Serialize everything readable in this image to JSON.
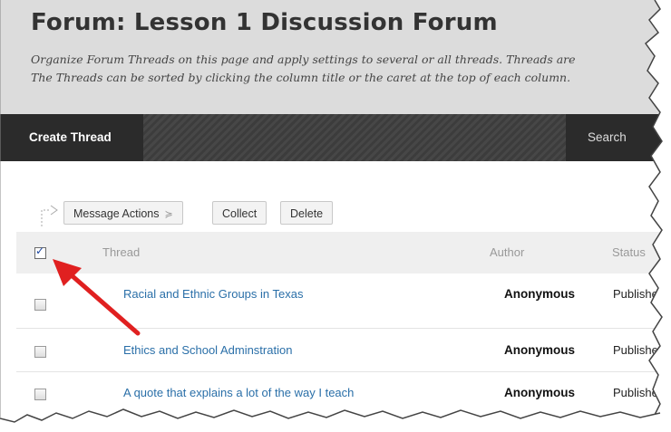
{
  "forum": {
    "title": "Forum: Lesson 1 Discussion Forum",
    "desc_line1": "Organize Forum Threads on this page and apply settings to several or all threads. Threads are",
    "desc_line2": "The Threads can be sorted by clicking the column title or the caret at the top of each column."
  },
  "actionbar": {
    "create_label": "Create Thread",
    "search_label": "Search"
  },
  "toolbar": {
    "message_actions_label": "Message Actions",
    "collect_label": "Collect",
    "delete_label": "Delete"
  },
  "table": {
    "headers": {
      "thread": "Thread",
      "author": "Author",
      "status": "Status"
    },
    "rows": [
      {
        "thread": "Racial and Ethnic Groups in Texas",
        "author": "Anonymous",
        "status": "Published"
      },
      {
        "thread": "Ethics and School Adminstration",
        "author": "Anonymous",
        "status": "Published"
      },
      {
        "thread": "A quote that explains a lot of the way I teach",
        "author": "Anonymous",
        "status": "Published"
      }
    ]
  },
  "colors": {
    "header_bg": "#dcdcdc",
    "actionbar_bg": "#2b2b2b",
    "link": "#2a6fa8",
    "annotation_arrow": "#e02020"
  }
}
